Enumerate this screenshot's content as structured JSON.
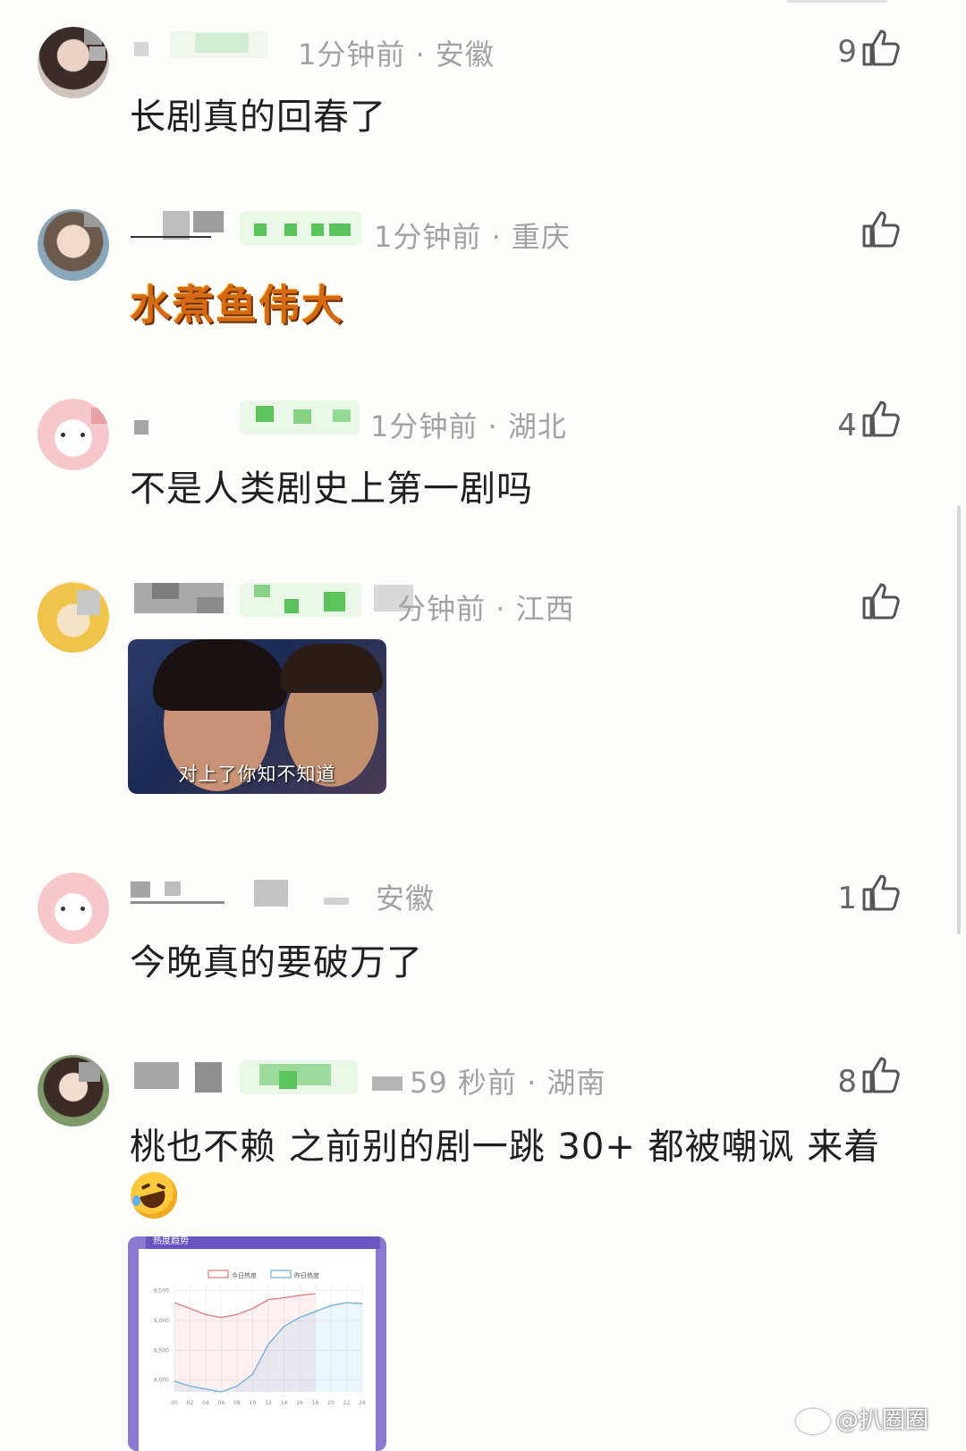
{
  "comments": [
    {
      "meta": "1分钟前 · 安徽",
      "text": "长剧真的回春了",
      "likes": "9"
    },
    {
      "meta": "1分钟前 · 重庆",
      "sticker_text": "水煮鱼伟大",
      "likes": ""
    },
    {
      "meta": "1分钟前 · 湖北",
      "text": "不是人类剧史上第一剧吗",
      "likes": "4"
    },
    {
      "meta": "分钟前 · 江西",
      "meme_caption": "对上了你知不知道",
      "likes": ""
    },
    {
      "meta": "安徽",
      "text": "今晚真的要破万了",
      "likes": "1"
    },
    {
      "meta": "59 秒前 · 湖南",
      "text": "桃也不赖  之前别的剧一跳 30+ 都被嘲讽 来着",
      "likes": "8"
    }
  ],
  "chart_data": {
    "type": "line",
    "title": "热度趋势",
    "x": [
      "00",
      "02",
      "04",
      "06",
      "08",
      "10",
      "12",
      "14",
      "16",
      "18",
      "20",
      "22",
      "24"
    ],
    "ylim": [
      7800,
      9600
    ],
    "yticks": [
      8000,
      8500,
      9000,
      9500
    ],
    "series": [
      {
        "name": "今日热度",
        "color": "#e07a7a",
        "values": [
          9300,
          9200,
          9100,
          9050,
          9100,
          9200,
          9350,
          9380,
          9420,
          9450,
          null,
          null,
          null
        ]
      },
      {
        "name": "昨日热度",
        "color": "#6aaee6",
        "values": [
          7980,
          7900,
          7850,
          7800,
          7900,
          8100,
          8600,
          8900,
          9050,
          9150,
          9250,
          9300,
          9280
        ]
      }
    ]
  },
  "watermark": "@扒圈圈"
}
